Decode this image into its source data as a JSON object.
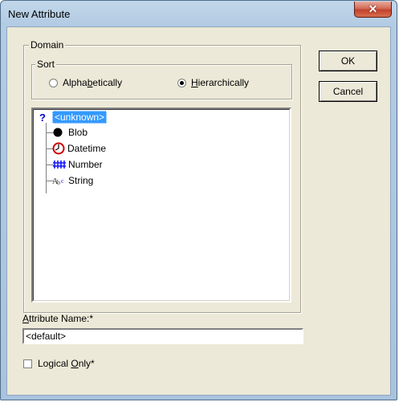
{
  "window": {
    "title": "New Attribute",
    "close_glyph": "✕"
  },
  "domain_group": {
    "label": "Domain",
    "sort_group": {
      "label": "Sort",
      "options": [
        {
          "label_before": "Alpha",
          "mnemonic": "b",
          "label_after": "etically",
          "checked": false
        },
        {
          "label_before": "",
          "mnemonic": "H",
          "label_after": "ierarchically",
          "checked": true
        }
      ]
    },
    "tree": {
      "root": {
        "icon": "question-icon",
        "label": "<unknown>",
        "selected": true
      },
      "children": [
        {
          "icon": "blob-icon",
          "label": "Blob"
        },
        {
          "icon": "datetime-icon",
          "label": "Datetime"
        },
        {
          "icon": "number-icon",
          "label": "Number"
        },
        {
          "icon": "string-icon",
          "label": "String"
        }
      ]
    }
  },
  "attribute_name": {
    "label_mnemonic": "A",
    "label_rest": "ttribute Name:*",
    "value": "<default>"
  },
  "logical_only": {
    "label_before": "Logical ",
    "mnemonic": "O",
    "label_after": "nly*",
    "checked": false
  },
  "buttons": {
    "ok": "OK",
    "cancel": "Cancel"
  },
  "colors": {
    "selection": "#3399ff",
    "close_button": "#c2422b",
    "dialog_face": "#ece9d8"
  }
}
